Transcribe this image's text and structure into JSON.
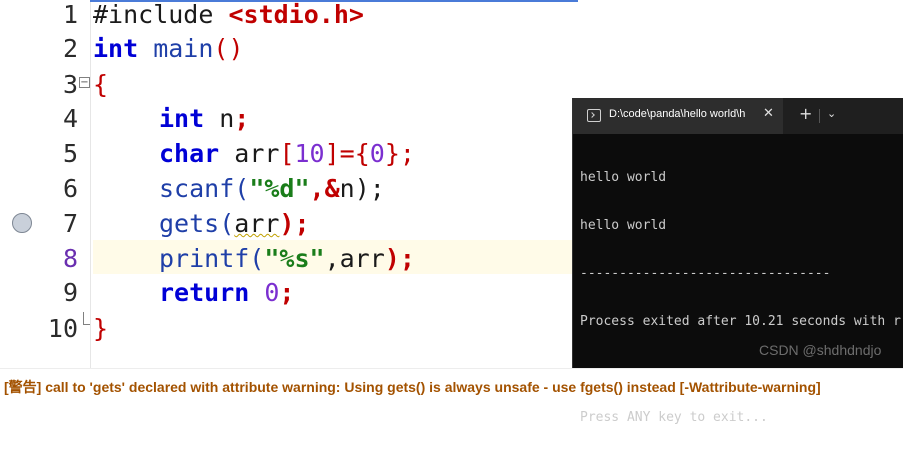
{
  "editor": {
    "lines": [
      {
        "num": "1"
      },
      {
        "num": "2"
      },
      {
        "num": "3"
      },
      {
        "num": "4"
      },
      {
        "num": "5"
      },
      {
        "num": "6"
      },
      {
        "num": "7"
      },
      {
        "num": "8"
      },
      {
        "num": "9"
      },
      {
        "num": "10"
      }
    ],
    "tokens": {
      "include": "#include ",
      "header": "<stdio.h>",
      "int": "int",
      "main": " main",
      "parens": "()",
      "open_brace": "{",
      "int2": "int",
      "n_decl": " n",
      "semi": ";",
      "char": "char",
      "arr_decl": " arr",
      "lb": "[",
      "ten": "10",
      "rb": "]",
      "eq_brace": "={",
      "zero": "0",
      "close_brace_semi": "};",
      "scanf": "scanf(",
      "fmt_d": "\"%d\"",
      "amp": ",&",
      "n_arg": "n);",
      "gets": "gets(",
      "arr_arg": "arr",
      "gets_close": ");",
      "printf": "printf(",
      "fmt_s": "\"%s\"",
      "comma_arr": ",arr",
      "printf_close": ");",
      "return": "return",
      "zero2": " 0",
      "semi2": ";",
      "close_brace": "}"
    }
  },
  "console": {
    "tab_title": "D:\\code\\panda\\hello world\\h",
    "close_glyph": "✕",
    "plus_glyph": "+",
    "dropdown_glyph": "⌄",
    "output_lines": [
      "hello world",
      "hello world",
      "--------------------------------",
      "Process exited after 10.21 seconds with r",
      "",
      "Press ANY key to exit..."
    ],
    "watermark": "CSDN @shdhdndjo"
  },
  "warning": {
    "text": "[警告] call to 'gets' declared with attribute warning: Using gets() is always unsafe - use fgets() instead [-Wattribute-warning]"
  },
  "colors": {
    "keyword": "#0000d6",
    "string": "#1a7d1a",
    "number": "#7b2fd0",
    "bracket": "#c00000",
    "warning": "#a35200",
    "console_bg": "#0c0c0c"
  }
}
